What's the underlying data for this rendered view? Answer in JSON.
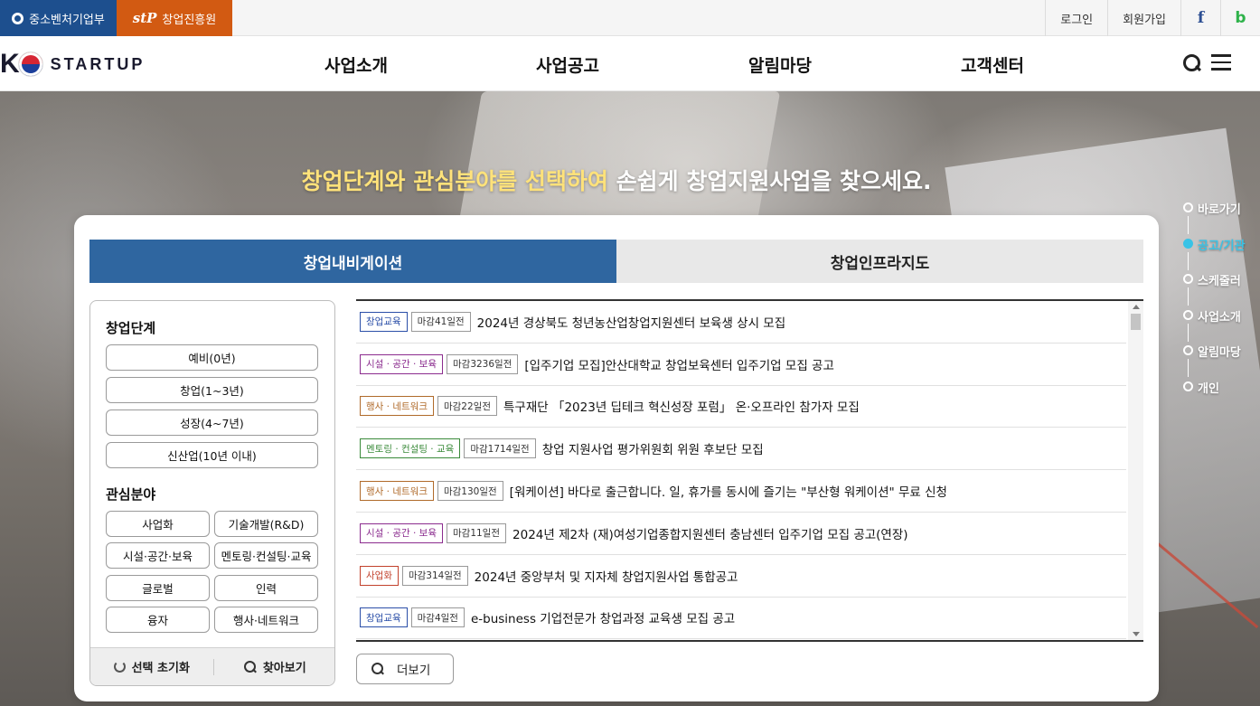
{
  "utility": {
    "gov_label": "중소벤처기업부",
    "kised_logo": "stP",
    "kised_label": "창업진흥원",
    "login": "로그인",
    "join": "회원가입",
    "facebook": "f",
    "blog": "b"
  },
  "header": {
    "brand_k": "K",
    "brand_word": "STARTUP",
    "menu": [
      "사업소개",
      "사업공고",
      "알림마당",
      "고객센터"
    ]
  },
  "hero": {
    "title_highlight": "창업단계와 관심분야를 선택하여",
    "title_rest": " 손쉽게 창업지원사업을 찾으세요."
  },
  "quick_nav": [
    {
      "label": "바로가기",
      "active": false
    },
    {
      "label": "공고/기관",
      "active": true
    },
    {
      "label": "스케줄러",
      "active": false
    },
    {
      "label": "사업소개",
      "active": false
    },
    {
      "label": "알림마당",
      "active": false
    },
    {
      "label": "개인",
      "active": false
    }
  ],
  "tabs": [
    "창업내비게이션",
    "창업인프라지도"
  ],
  "filter": {
    "stage_heading": "창업단계",
    "stages": [
      "예비(0년)",
      "창업(1~3년)",
      "성장(4~7년)",
      "신산업(10년 이내)"
    ],
    "field_heading": "관심분야",
    "fields": [
      "사업화",
      "기술개발(R&D)",
      "시설·공간·보육",
      "멘토링·컨설팅·교육",
      "글로벌",
      "인력",
      "융자",
      "행사·네트워크"
    ],
    "reset_label": "선택 초기화",
    "search_label": "찾아보기"
  },
  "colors": {
    "tag_edu": "#2b4fa8",
    "tag_space": "#8b2c8e",
    "tag_event": "#b06a2a",
    "tag_mentor": "#3a8a3a",
    "tag_biz": "#c2412c",
    "tab_active": "#2f66a0",
    "quick_active": "#39c3e6"
  },
  "list": [
    {
      "tag": "창업교육",
      "tag_color": "#2b4fa8",
      "dday": "마감41일전",
      "title": "2024년 경상북도 청년농산업창업지원센터 보육생 상시 모집"
    },
    {
      "tag": "시설 · 공간 · 보육",
      "tag_color": "#8b2c8e",
      "dday": "마감3236일전",
      "title": "[입주기업 모집]안산대학교 창업보육센터 입주기업 모집 공고"
    },
    {
      "tag": "행사 · 네트워크",
      "tag_color": "#b06a2a",
      "dday": "마감22일전",
      "title": "특구재단 「2023년 딥테크 혁신성장 포럼」 온·오프라인 참가자 모집"
    },
    {
      "tag": "멘토링 · 컨설팅 · 교육",
      "tag_color": "#3a8a3a",
      "dday": "마감1714일전",
      "title": "창업 지원사업 평가위원회 위원 후보단 모집"
    },
    {
      "tag": "행사 · 네트워크",
      "tag_color": "#b06a2a",
      "dday": "마감130일전",
      "title": "[워케이션] 바다로 출근합니다. 일, 휴가를 동시에 즐기는 \"부산형 워케이션\" 무료 신청"
    },
    {
      "tag": "시설 · 공간 · 보육",
      "tag_color": "#8b2c8e",
      "dday": "마감11일전",
      "title": "2024년 제2차 (재)여성기업종합지원센터 충남센터 입주기업 모집 공고(연장)"
    },
    {
      "tag": "사업화",
      "tag_color": "#c2412c",
      "dday": "마감314일전",
      "title": "2024년 중앙부처 및 지자체 창업지원사업 통합공고"
    },
    {
      "tag": "창업교육",
      "tag_color": "#2b4fa8",
      "dday": "마감4일전",
      "title": "e-business 기업전문가 창업과정 교육생 모집 공고"
    }
  ],
  "more_label": "더보기"
}
